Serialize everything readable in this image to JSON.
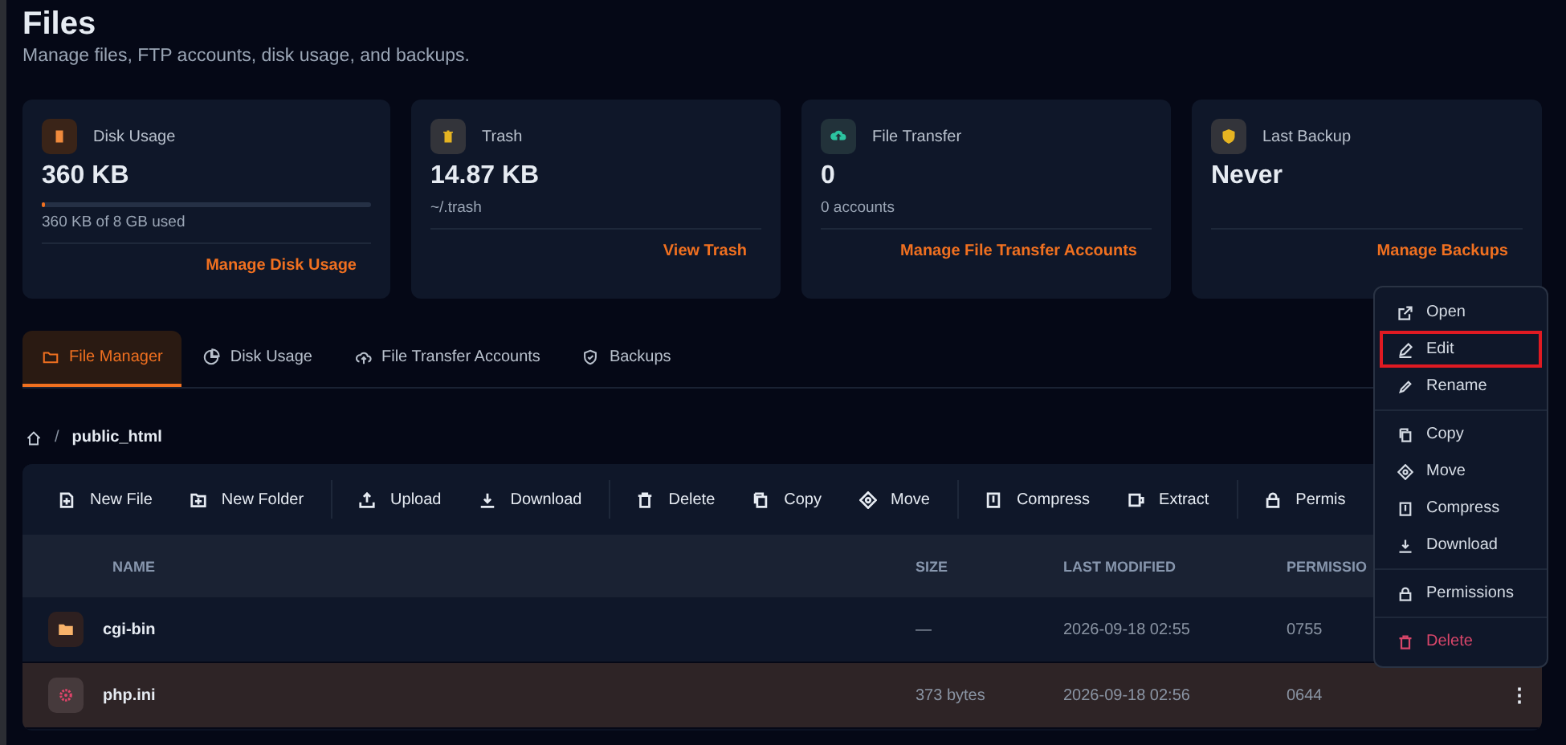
{
  "header": {
    "title": "Files",
    "subtitle": "Manage files, FTP accounts, disk usage, and backups."
  },
  "cards": [
    {
      "label": "Disk Usage",
      "value": "360 KB",
      "meter": {
        "level": 0.01
      },
      "detail": "360 KB of 8 GB used",
      "link": "Manage Disk Usage"
    },
    {
      "label": "Trash",
      "value": "14.87 KB",
      "detail": "~/.trash",
      "link": "View Trash"
    },
    {
      "label": "File Transfer",
      "value": "0",
      "detail": "0 accounts",
      "link": "Manage File Transfer Accounts"
    },
    {
      "label": "Last Backup",
      "value": "Never",
      "link": "Manage Backups"
    }
  ],
  "tabs": [
    {
      "label": "File Manager",
      "selected": true
    },
    {
      "label": "Disk Usage",
      "selected": false
    },
    {
      "label": "File Transfer Accounts",
      "selected": false
    },
    {
      "label": "Backups",
      "selected": false
    }
  ],
  "breadcrumb": {
    "separator": "/",
    "path": "public_html"
  },
  "toolbar": [
    [
      "New File",
      "New Folder"
    ],
    [
      "Upload",
      "Download"
    ],
    [
      "Delete",
      "Copy",
      "Move"
    ],
    [
      "Compress",
      "Extract"
    ],
    [
      "Permis"
    ]
  ],
  "table": {
    "columns": [
      "NAME",
      "SIZE",
      "LAST MODIFIED",
      "PERMISSIO"
    ],
    "rows": [
      {
        "kind": "folder",
        "name": "cgi-bin",
        "size": "—",
        "modified": "2026-09-18 02:55",
        "permissions": "0755",
        "selected": false
      },
      {
        "kind": "file",
        "name": "php.ini",
        "size": "373 bytes",
        "modified": "2026-09-18 02:56",
        "permissions": "0644",
        "selected": true,
        "actions": "⋮"
      }
    ]
  },
  "context_menu": [
    [
      {
        "label": "Open",
        "highlighted": false,
        "danger": false
      },
      {
        "label": "Edit",
        "highlighted": true,
        "danger": false
      },
      {
        "label": "Rename",
        "highlighted": false,
        "danger": false
      }
    ],
    [
      {
        "label": "Copy",
        "highlighted": false,
        "danger": false
      },
      {
        "label": "Move",
        "highlighted": false,
        "danger": false
      },
      {
        "label": "Compress",
        "highlighted": false,
        "danger": false
      },
      {
        "label": "Download",
        "highlighted": false,
        "danger": false
      }
    ],
    [
      {
        "label": "Permissions",
        "highlighted": false,
        "danger": false
      }
    ],
    [
      {
        "label": "Delete",
        "highlighted": false,
        "danger": true
      }
    ]
  ]
}
